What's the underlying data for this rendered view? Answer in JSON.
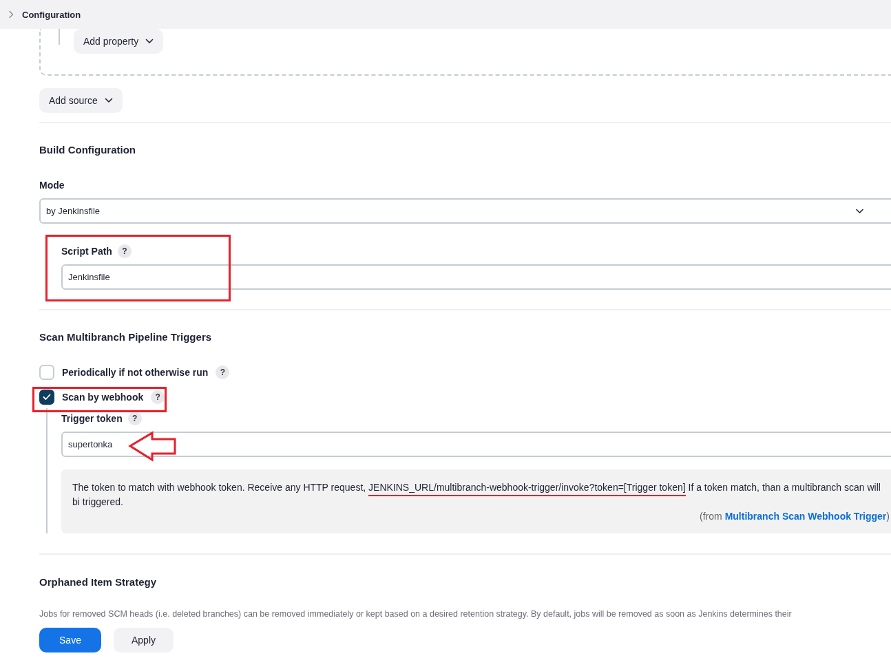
{
  "breadcrumb": {
    "label": "Configuration"
  },
  "source_section": {
    "add_property_button": "Add property",
    "add_source_button": "Add source"
  },
  "build_configuration": {
    "title": "Build Configuration",
    "mode_label": "Mode",
    "mode_value": "by Jenkinsfile",
    "script_path_label": "Script Path",
    "script_path_help": "?",
    "script_path_value": "Jenkinsfile"
  },
  "triggers": {
    "title": "Scan Multibranch Pipeline Triggers",
    "options": [
      {
        "label": "Periodically if not otherwise run",
        "help": "?",
        "checked": false
      },
      {
        "label": "Scan by webhook",
        "help": "?",
        "checked": true
      }
    ],
    "trigger_token_label": "Trigger token",
    "trigger_token_help": "?",
    "trigger_token_value": "supertonka",
    "help_text": [
      {
        "text": "The token to match with webhook token. Receive any HTTP request, ",
        "underlined": false
      },
      {
        "text": "JENKINS_URL/multibranch-webhook-trigger/invoke?token=[Trigger token]",
        "underlined": true
      },
      {
        "text": " If a token match, than a multibranch scan will bi triggered.",
        "underlined": false
      }
    ],
    "help_source_prefix": "(from ",
    "help_source_link": "Multibranch Scan Webhook Trigger",
    "help_source_suffix": ")"
  },
  "orphaned": {
    "title": "Orphaned Item Strategy",
    "description": "Jobs for removed SCM heads (i.e. deleted branches) can be removed immediately or kept based on a desired retention strategy. By default, jobs will be removed as soon as Jenkins determines their"
  },
  "buttons": [
    {
      "label": "Save",
      "kind": "primary"
    },
    {
      "label": "Apply",
      "kind": "secondary"
    }
  ]
}
